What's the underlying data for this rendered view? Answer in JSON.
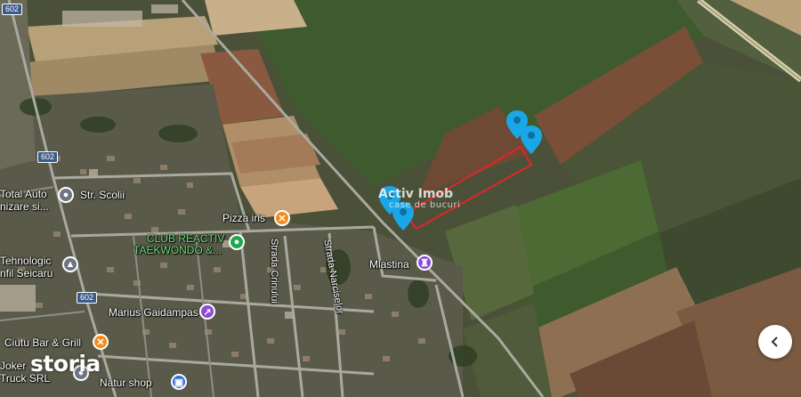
{
  "map": {
    "road_shields": [
      "602",
      "602",
      "602"
    ],
    "places": [
      {
        "text": "Str. Scolii",
        "icon": "school"
      },
      {
        "text": "Total Auto",
        "icon": ""
      },
      {
        "text": "nizare si...",
        "icon": ""
      },
      {
        "text": "Pizza iris",
        "icon": "restaurant"
      },
      {
        "text": "CLUB REACTIV",
        "icon": "sports"
      },
      {
        "text": "TAEKWONDO &...",
        "icon": ""
      },
      {
        "text": "Tehnologic",
        "icon": "school"
      },
      {
        "text": "nfil Seicaru",
        "icon": ""
      },
      {
        "text": "Strada Crinului",
        "icon": ""
      },
      {
        "text": "Strada Narciselor",
        "icon": ""
      },
      {
        "text": "Mlastina",
        "icon": "landmark"
      },
      {
        "text": "Marius Gaidampas",
        "icon": "service"
      },
      {
        "text": "Ciutu Bar & Grill",
        "icon": "restaurant"
      },
      {
        "text": "Joker",
        "icon": ""
      },
      {
        "text": "Truck SRL",
        "icon": ""
      },
      {
        "text": "Natur shop",
        "icon": "shop"
      }
    ],
    "markers": [
      "location-pin-icon",
      "location-pin-icon",
      "location-pin-icon",
      "location-pin-icon"
    ],
    "colors": {
      "boundary": "#e0242c",
      "marker": "#1aa7e8",
      "restaurant": "#f28b1a",
      "sports": "#1fa851",
      "landmark": "#8a4bd6",
      "shop": "#2a6fdb"
    }
  },
  "watermark": {
    "brand": "Activ Imob",
    "sub": "case de bucuri"
  },
  "logo": "storia",
  "nav_icon": "chevron-left-icon"
}
